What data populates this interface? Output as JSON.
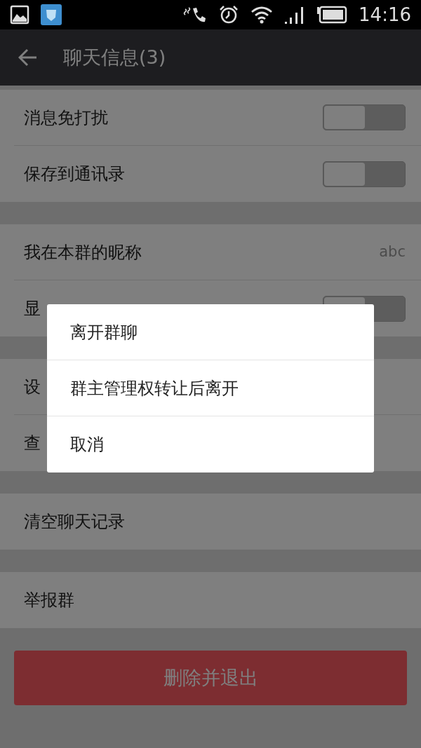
{
  "status_bar": {
    "time": "14:16"
  },
  "app_bar": {
    "title": "聊天信息(3)"
  },
  "sections": [
    {
      "rows": [
        {
          "kind": "toggle",
          "label": "消息免打扰",
          "on": false
        },
        {
          "kind": "toggle",
          "label": "保存到通讯录",
          "on": false
        }
      ]
    },
    {
      "rows": [
        {
          "kind": "value",
          "label": "我在本群的昵称",
          "value": "abc"
        },
        {
          "kind": "toggle",
          "label": "显",
          "on": false
        }
      ]
    },
    {
      "rows": [
        {
          "kind": "link",
          "label": "设"
        },
        {
          "kind": "link",
          "label": "查"
        }
      ]
    },
    {
      "rows": [
        {
          "kind": "link",
          "label": "清空聊天记录"
        }
      ]
    },
    {
      "rows": [
        {
          "kind": "link",
          "label": "举报群"
        }
      ]
    }
  ],
  "delete_button": "删除并退出",
  "dialog": {
    "items": [
      "离开群聊",
      "群主管理权转让后离开",
      "取消"
    ]
  }
}
